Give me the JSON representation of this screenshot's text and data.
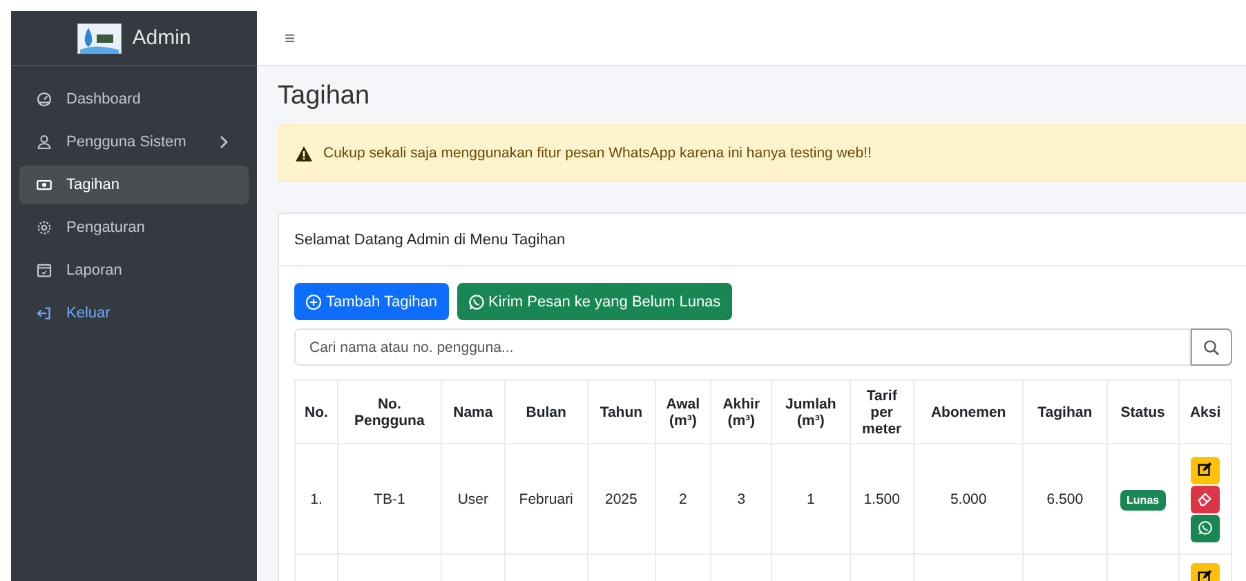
{
  "sidebar": {
    "brand": "Admin",
    "items": [
      {
        "label": "Dashboard",
        "selected": false,
        "kind": "link"
      },
      {
        "label": "Pengguna Sistem",
        "selected": false,
        "kind": "submenu"
      },
      {
        "label": "Tagihan",
        "selected": true,
        "kind": "link"
      },
      {
        "label": "Pengaturan",
        "selected": false,
        "kind": "link"
      },
      {
        "label": "Laporan",
        "selected": false,
        "kind": "link"
      },
      {
        "label": "Keluar",
        "selected": false,
        "kind": "logout"
      }
    ]
  },
  "topbar": {
    "menu_icon": "≡"
  },
  "page_title": "Tagihan",
  "alert": {
    "text": "Cukup sekali saja menggunakan fitur pesan WhatsApp karena ini hanya testing web!!"
  },
  "card": {
    "header": "Selamat Datang Admin di Menu Tagihan",
    "buttons": [
      {
        "label": "Tambah Tagihan",
        "kind": "add"
      },
      {
        "label": "Kirim Pesan ke yang Belum Lunas",
        "kind": "whatsapp"
      }
    ],
    "search": {
      "placeholder": "Cari nama atau no. pengguna..."
    },
    "table": {
      "columns": [
        "No.",
        "No. Pengguna",
        "Nama",
        "Bulan",
        "Tahun",
        "Awal (m³)",
        "Akhir (m³)",
        "Jumlah (m³)",
        "Tarif per meter",
        "Abonemen",
        "Tagihan",
        "Status",
        "Aksi"
      ],
      "rows": [
        {
          "cells": [
            "1.",
            "TB-1",
            "User",
            "Februari",
            "2025",
            "2",
            "3",
            "1",
            "1.500",
            "5.000",
            "6.500"
          ],
          "status": {
            "label": "Lunas",
            "kind": "paid"
          },
          "actions": [
            {
              "kind": "edit"
            },
            {
              "kind": "delete"
            },
            {
              "kind": "whatsapp"
            }
          ]
        },
        {
          "actions": [
            {
              "kind": "edit"
            }
          ]
        }
      ]
    }
  }
}
